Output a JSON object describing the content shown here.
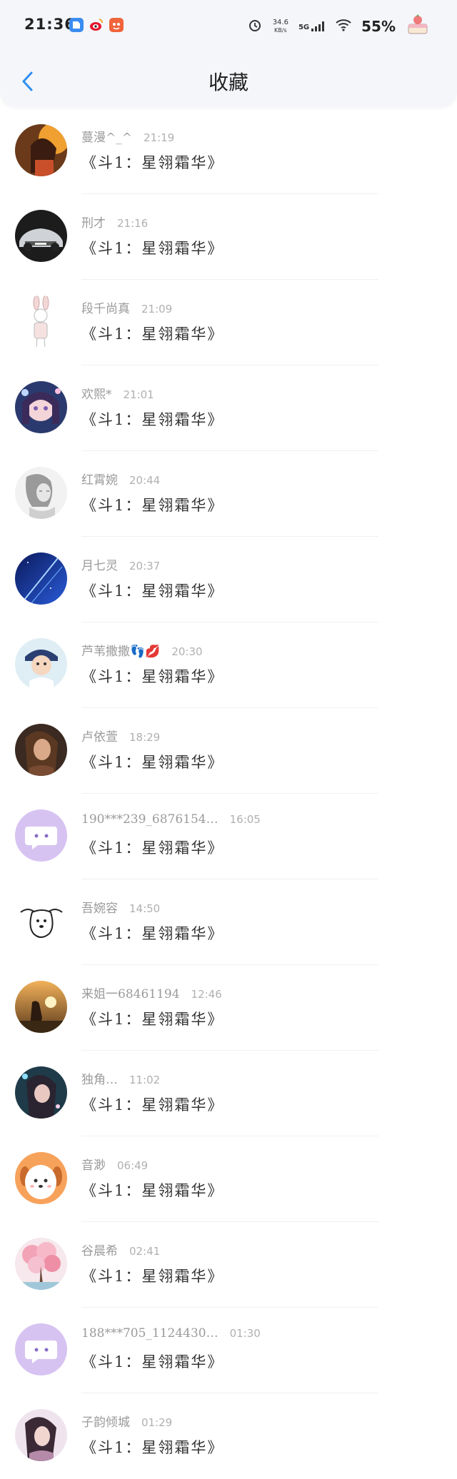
{
  "status_bar": {
    "time": "21:36",
    "net_speed": "34.6",
    "net_unit": "KB/s",
    "signal": "5G",
    "battery": "55%"
  },
  "header": {
    "title": "收藏",
    "accent_color": "#2f8ff0"
  },
  "favorites": [
    {
      "name": "蔓漫^_^",
      "time": "21:19",
      "title": "《斗1：星翎霜华》",
      "avatar": "girl-photo-orange"
    },
    {
      "name": "刑才",
      "time": "21:16",
      "title": "《斗1：星翎霜华》",
      "avatar": "car-photo"
    },
    {
      "name": "段千尚真",
      "time": "21:09",
      "title": "《斗1：星翎霜华》",
      "avatar": "rabbit-sketch"
    },
    {
      "name": "欢熙*",
      "time": "21:01",
      "title": "《斗1：星翎霜华》",
      "avatar": "anime-girl"
    },
    {
      "name": "红霄婉",
      "time": "20:44",
      "title": "《斗1：星翎霜华》",
      "avatar": "ink-portrait"
    },
    {
      "name": "月七灵",
      "time": "20:37",
      "title": "《斗1：星翎霜华》",
      "avatar": "blue-night-sky"
    },
    {
      "name": "芦苇撒撒👣💋",
      "time": "20:30",
      "title": "《斗1：星翎霜华》",
      "avatar": "baby-photo"
    },
    {
      "name": "卢依萱",
      "time": "18:29",
      "title": "《斗1：星翎霜华》",
      "avatar": "woman-photo"
    },
    {
      "name": "190***239_6876154…",
      "time": "16:05",
      "title": "《斗1：星翎霜华》",
      "avatar": "default-purple"
    },
    {
      "name": "吾婉容",
      "time": "14:50",
      "title": "《斗1：星翎霜华》",
      "avatar": "dog-doodle"
    },
    {
      "name": "来姐一68461194",
      "time": "12:46",
      "title": "《斗1：星翎霜华》",
      "avatar": "sunset-silhouette"
    },
    {
      "name": "独角…",
      "time": "11:02",
      "title": "《斗1：星翎霜华》",
      "avatar": "fantasy-girl"
    },
    {
      "name": "音渺",
      "time": "06:49",
      "title": "《斗1：星翎霜华》",
      "avatar": "cartoon-dog"
    },
    {
      "name": "谷晨希",
      "time": "02:41",
      "title": "《斗1：星翎霜华》",
      "avatar": "blossom-tree"
    },
    {
      "name": "188***705_1124430…",
      "time": "01:30",
      "title": "《斗1：星翎霜华》",
      "avatar": "default-purple"
    },
    {
      "name": "子韵倾城",
      "time": "01:29",
      "title": "《斗1：星翎霜华》",
      "avatar": "girl-portrait"
    }
  ]
}
